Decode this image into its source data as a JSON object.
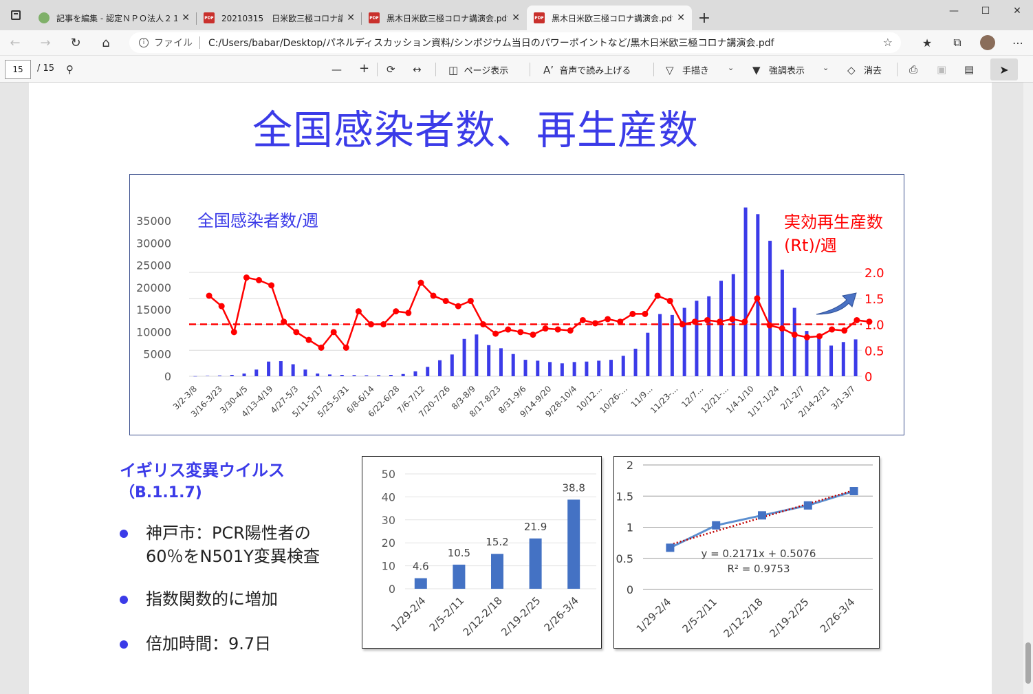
{
  "browser": {
    "tabs": [
      {
        "title": "記事を編集 - 認定ＮＰＯ法人２１",
        "favicon": "green",
        "active": false
      },
      {
        "title": "20210315　日米欧三極コロナ講演",
        "favicon": "pdf",
        "active": false
      },
      {
        "title": "黒木日米欧三極コロナ講演会.pdf",
        "favicon": "pdf",
        "active": false
      },
      {
        "title": "黒木日米欧三極コロナ講演会.pdf",
        "favicon": "pdf",
        "active": true
      }
    ],
    "address": {
      "scheme": "ファイル",
      "path": "C:/Users/babar/Desktop/パネルディスカッション資料/シンポジウム当日のパワーポイントなど/黒木日米欧三極コロナ講演会.pdf"
    }
  },
  "pdf_toolbar": {
    "page_current": "15",
    "page_total": "/ 15",
    "page_view_label": "ページ表示",
    "read_aloud_label": "音声で読み上げる",
    "draw_label": "手描き",
    "highlight_label": "強調表示",
    "erase_label": "消去"
  },
  "slide": {
    "title": "全国感染者数、再生産数",
    "uk_title": "イギリス変異ウイルス",
    "uk_sub": "（B.1.1.7)",
    "bullets": [
      [
        "神戸市：PCR陽性者の",
        "60％をN501Y変異検査"
      ],
      [
        "指数関数的に増加"
      ],
      [
        "倍加時間：9.7日"
      ]
    ]
  },
  "colors": {
    "accent": "#3b3be8",
    "red": "#ff0000",
    "bar_blue": "#4472c4",
    "trend_red": "#c00000"
  },
  "chart_data": [
    {
      "type": "bar",
      "combo": "bar+line",
      "left_label": "全国感染者数/週",
      "right_label_line1": "実効再生産数",
      "right_label_line2": "(Rt)/週",
      "y_ticks": [
        "35000",
        "30000",
        "25000",
        "20000",
        "15000",
        "10000",
        "5000",
        "0"
      ],
      "y2_ticks": [
        "2.0",
        "1.5",
        "1.0",
        "0.5",
        "0"
      ],
      "ylim": [
        0,
        35000
      ],
      "y2lim": [
        0,
        2.0
      ],
      "reference_line_y2": 1.0,
      "x_tick_labels": [
        "3/2-3/8",
        "3/16-3/23",
        "3/30-4/5",
        "4/13-4/19",
        "4/27-5/3",
        "5/11-5/17",
        "5/25-5/31",
        "6/8-6/14",
        "6/22-6/28",
        "7/6-7/12",
        "7/20-7/26",
        "8/3-8/9",
        "8/17-8/23",
        "8/31-9/6",
        "9/14-9/20",
        "9/28-10/4",
        "10/12...",
        "10/26-...",
        "11/9...",
        "11/23-...",
        "12/7...",
        "12/21-...",
        "1/4-1/10",
        "1/17-1/24",
        "2/1-2/7",
        "2/14-2/21",
        "3/1-3/7"
      ],
      "bars": [
        30,
        80,
        150,
        300,
        600,
        1500,
        3300,
        3400,
        2700,
        1500,
        600,
        400,
        300,
        250,
        200,
        220,
        300,
        500,
        1100,
        2100,
        3600,
        4900,
        8400,
        9400,
        7000,
        6300,
        5000,
        3700,
        3500,
        3200,
        2900,
        3200,
        3300,
        3500,
        3700,
        4600,
        6200,
        9800,
        14000,
        13800,
        15400,
        17000,
        18000,
        21500,
        23000,
        38000,
        36500,
        30500,
        24000,
        15400,
        10200,
        8700,
        6900,
        7700,
        8300
      ],
      "rt": [
        1.55,
        1.35,
        0.85,
        1.9,
        1.85,
        1.75,
        1.05,
        0.85,
        0.7,
        0.55,
        0.85,
        0.55,
        1.25,
        1.0,
        1.0,
        1.25,
        1.22,
        1.8,
        1.55,
        1.45,
        1.35,
        1.45,
        1.0,
        0.82,
        0.9,
        0.85,
        0.8,
        0.92,
        0.9,
        0.88,
        1.08,
        1.02,
        1.1,
        1.05,
        1.2,
        1.2,
        1.55,
        1.45,
        1.0,
        1.05,
        1.08,
        1.05,
        1.1,
        1.05,
        1.5,
        0.98,
        0.92,
        0.8,
        0.75,
        0.77,
        0.9,
        0.88,
        1.08,
        1.05
      ]
    },
    {
      "type": "bar",
      "categories": [
        "1/29-2/4",
        "2/5-2/11",
        "2/12-2/18",
        "2/19-2/25",
        "2/26-3/4"
      ],
      "values": [
        4.6,
        10.5,
        15.2,
        21.9,
        38.8
      ],
      "data_labels": [
        "4.6",
        "10.5",
        "15.2",
        "21.9",
        "38.8"
      ],
      "y_ticks": [
        "50",
        "40",
        "30",
        "20",
        "10",
        "0"
      ],
      "ylim": [
        0,
        50
      ]
    },
    {
      "type": "line",
      "categories": [
        "1/29-2/4",
        "2/5-2/11",
        "2/12-2/18",
        "2/19-2/25",
        "2/26-3/4"
      ],
      "values": [
        0.67,
        1.03,
        1.19,
        1.35,
        1.58
      ],
      "y_ticks": [
        "2",
        "1.5",
        "1",
        "0.5",
        "0"
      ],
      "ylim": [
        0,
        2
      ],
      "trendline": {
        "slope": 0.2171,
        "intercept": 0.5076
      },
      "equation": "y = 0.2171x + 0.5076",
      "r2": "R² = 0.9753"
    }
  ]
}
